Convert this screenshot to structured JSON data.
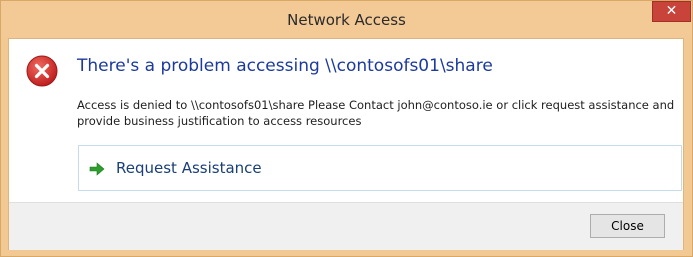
{
  "window": {
    "title": "Network Access",
    "close_glyph": "✕"
  },
  "content": {
    "icon": "error-icon",
    "heading": "There's a problem accessing \\\\contosofs01\\share",
    "message": "Access is denied to \\\\contosofs01\\share Please Contact john@contoso.ie or click request assistance and provide business justification to access resources",
    "command_link": {
      "icon": "green-arrow-right-icon",
      "label": "Request Assistance"
    }
  },
  "footer": {
    "close_label": "Close"
  },
  "colors": {
    "title_bar": "#f3c996",
    "close_button_red": "#c8433a",
    "heading_blue": "#1c3a9c",
    "error_red": "#d32a2a",
    "arrow_green": "#2e9e2e"
  }
}
